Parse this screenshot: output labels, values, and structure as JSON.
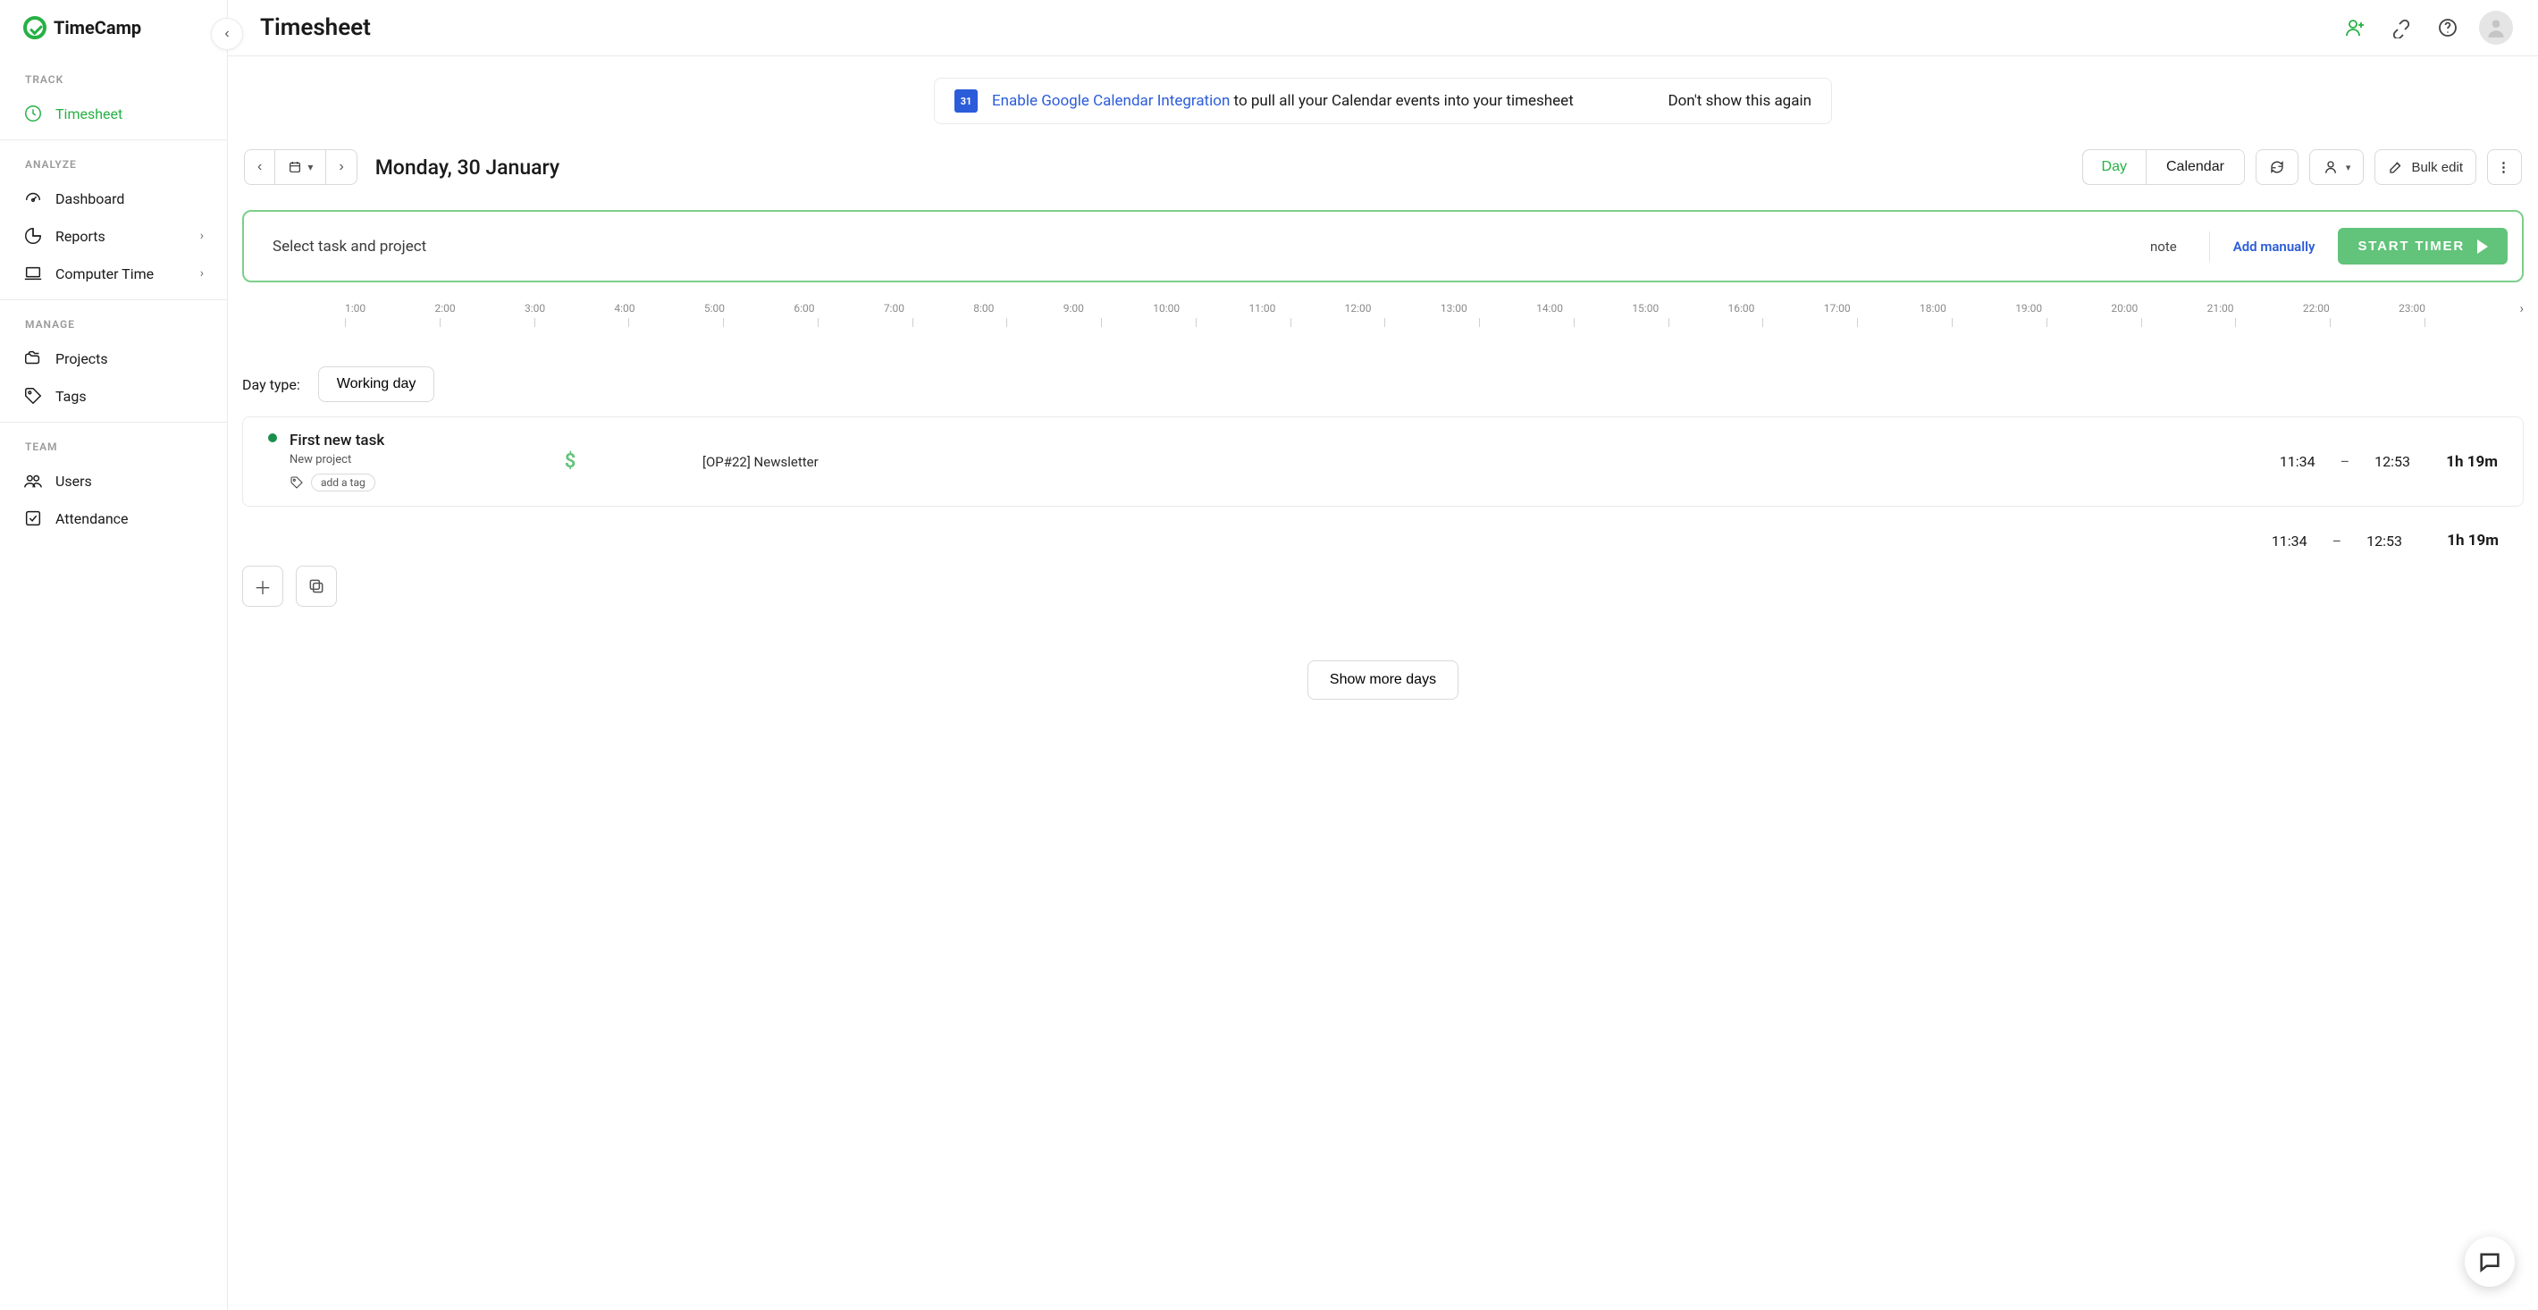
{
  "brand": {
    "name": "TimeCamp"
  },
  "page": {
    "title": "Timesheet"
  },
  "sidebar": {
    "sections": {
      "track": {
        "title": "TRACK",
        "items": [
          {
            "label": "Timesheet",
            "active": true
          }
        ]
      },
      "analyze": {
        "title": "ANALYZE",
        "items": [
          {
            "label": "Dashboard"
          },
          {
            "label": "Reports",
            "chevron": true
          },
          {
            "label": "Computer Time",
            "chevron": true
          }
        ]
      },
      "manage": {
        "title": "MANAGE",
        "items": [
          {
            "label": "Projects"
          },
          {
            "label": "Tags"
          }
        ]
      },
      "team": {
        "title": "TEAM",
        "items": [
          {
            "label": "Users"
          },
          {
            "label": "Attendance"
          }
        ]
      }
    }
  },
  "banner": {
    "badge_text": "31",
    "link_text": "Enable Google Calendar Integration",
    "tail_text": " to pull all your Calendar events into your timesheet",
    "dismiss_text": "Don't show this again"
  },
  "toolbar": {
    "date_label": "Monday, 30 January",
    "view_tabs": {
      "day": "Day",
      "calendar": "Calendar"
    },
    "bulk_edit": "Bulk edit"
  },
  "timer": {
    "placeholder": "Select task and project",
    "note_label": "note",
    "add_manually": "Add manually",
    "start_label": "START TIMER"
  },
  "timeline_hours": [
    "1:00",
    "2:00",
    "3:00",
    "4:00",
    "5:00",
    "6:00",
    "7:00",
    "8:00",
    "9:00",
    "10:00",
    "11:00",
    "12:00",
    "13:00",
    "14:00",
    "15:00",
    "16:00",
    "17:00",
    "18:00",
    "19:00",
    "20:00",
    "21:00",
    "22:00",
    "23:00"
  ],
  "day_type": {
    "label": "Day type:",
    "value": "Working day"
  },
  "entries": [
    {
      "task": "First new task",
      "project": "New project",
      "tag_placeholder": "add a tag",
      "billable": true,
      "reference": "[OP#22] Newsletter",
      "start": "11:34",
      "end": "12:53",
      "duration": "1h 19m"
    }
  ],
  "totals": {
    "start": "11:34",
    "end": "12:53",
    "duration": "1h 19m"
  },
  "show_more": "Show more days"
}
